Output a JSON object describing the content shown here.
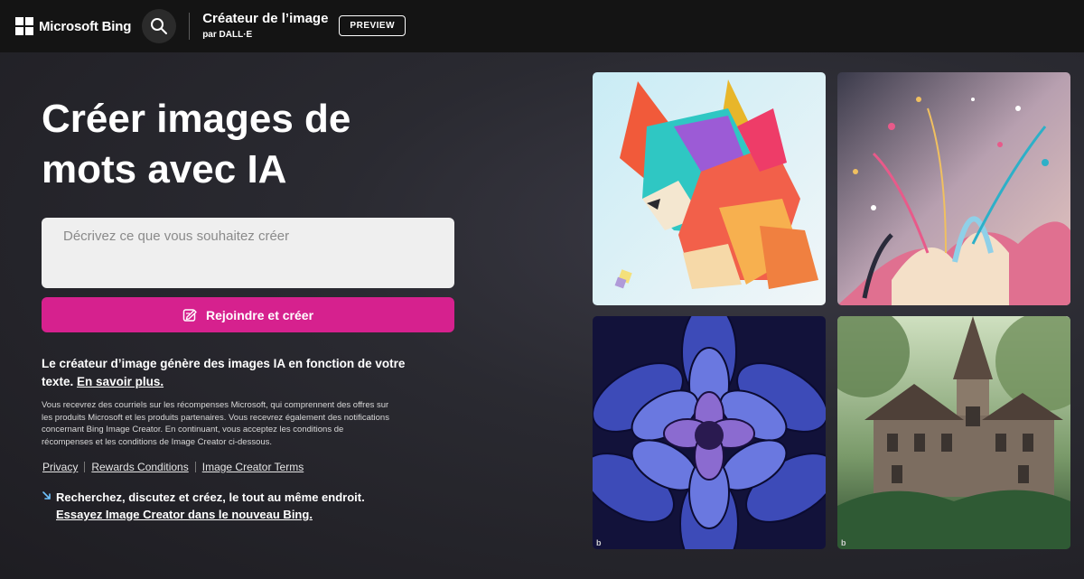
{
  "header": {
    "logo_text": "Microsoft Bing",
    "title": "Créateur de l’image",
    "subtitle": "par DALL·E",
    "badge": "PREVIEW"
  },
  "hero": {
    "title": "Créer images de mots avec IA"
  },
  "prompt": {
    "placeholder": "Décrivez ce que vous souhaitez créer",
    "value": ""
  },
  "create_button": {
    "label": "Rejoindre et créer"
  },
  "description": {
    "text": "Le créateur d’image génère des images IA en fonction de votre texte.",
    "link": "En savoir plus."
  },
  "fine_print": "Vous recevrez des courriels sur les récompenses Microsoft, qui comprennent des offres sur les produits Microsoft et les produits partenaires. Vous recevrez également des notifications concernant Bing Image Creator. En continuant, vous acceptez les conditions de récompenses et les conditions de Image Creator ci-dessous.",
  "footer_links": [
    "Privacy",
    "Rewards Conditions",
    "Image Creator Terms"
  ],
  "promo": {
    "text": "Recherchez, discutez et créez, le tout au même endroit.",
    "link": "Essayez Image Creator dans le nouveau Bing."
  },
  "gallery": {
    "watermark": "b",
    "tiles": [
      "fox-papercraft-image",
      "paint-splash-image",
      "blue-dahlia-image",
      "forest-castle-image"
    ]
  },
  "colors": {
    "accent": "#d6218e",
    "topbar": "#141414",
    "background": "#2a2a31"
  }
}
